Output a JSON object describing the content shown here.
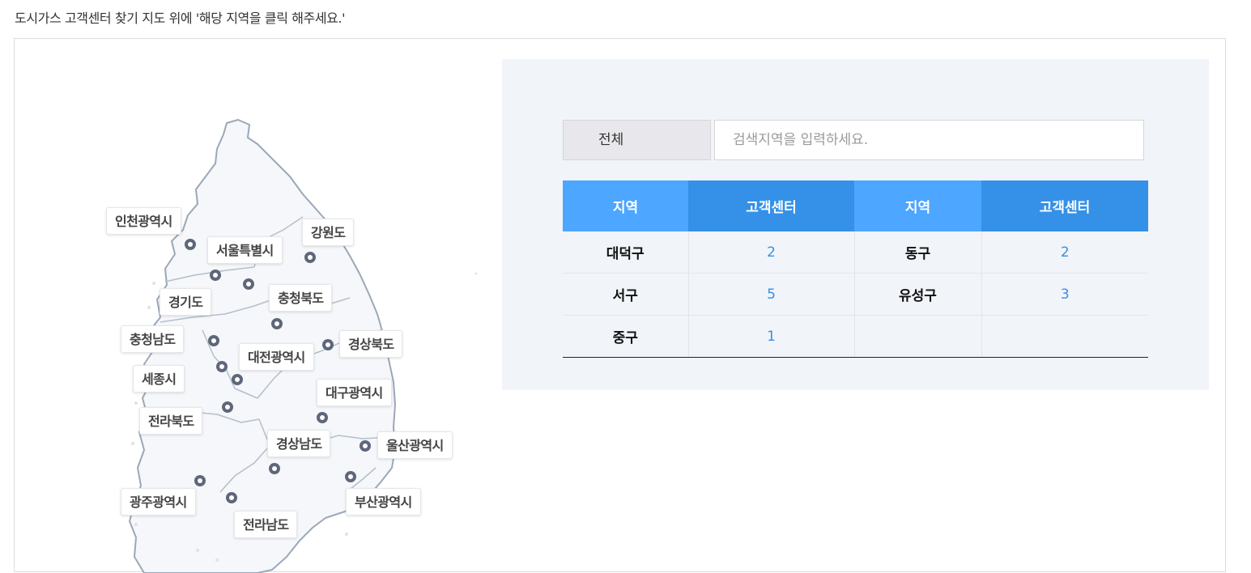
{
  "intro": "도시가스 고객센터 찾기 지도 위에 '해당 지역을 클릭 해주세요.'",
  "colors": {
    "header_light": "#4da6ff",
    "header_dark": "#3590e8",
    "count_text": "#3590e8",
    "panel_bg": "#f1f4f8",
    "pin": "#5e6779"
  },
  "map": {
    "labels": [
      "인천광역시",
      "서울특별시",
      "강원도",
      "경기도",
      "충청북도",
      "충청남도",
      "경상북도",
      "대전광역시",
      "세종시",
      "대구광역시",
      "전라북도",
      "경상남도",
      "울산광역시",
      "광주광역시",
      "부산광역시",
      "전라남도"
    ]
  },
  "search": {
    "select_value": "전체",
    "placeholder": "검색지역을 입력하세요."
  },
  "table": {
    "headers": [
      "지역",
      "고객센터",
      "지역",
      "고객센터"
    ],
    "rows": [
      [
        "대덕구",
        "2",
        "동구",
        "2"
      ],
      [
        "서구",
        "5",
        "유성구",
        "3"
      ],
      [
        "중구",
        "1",
        "",
        ""
      ]
    ]
  }
}
